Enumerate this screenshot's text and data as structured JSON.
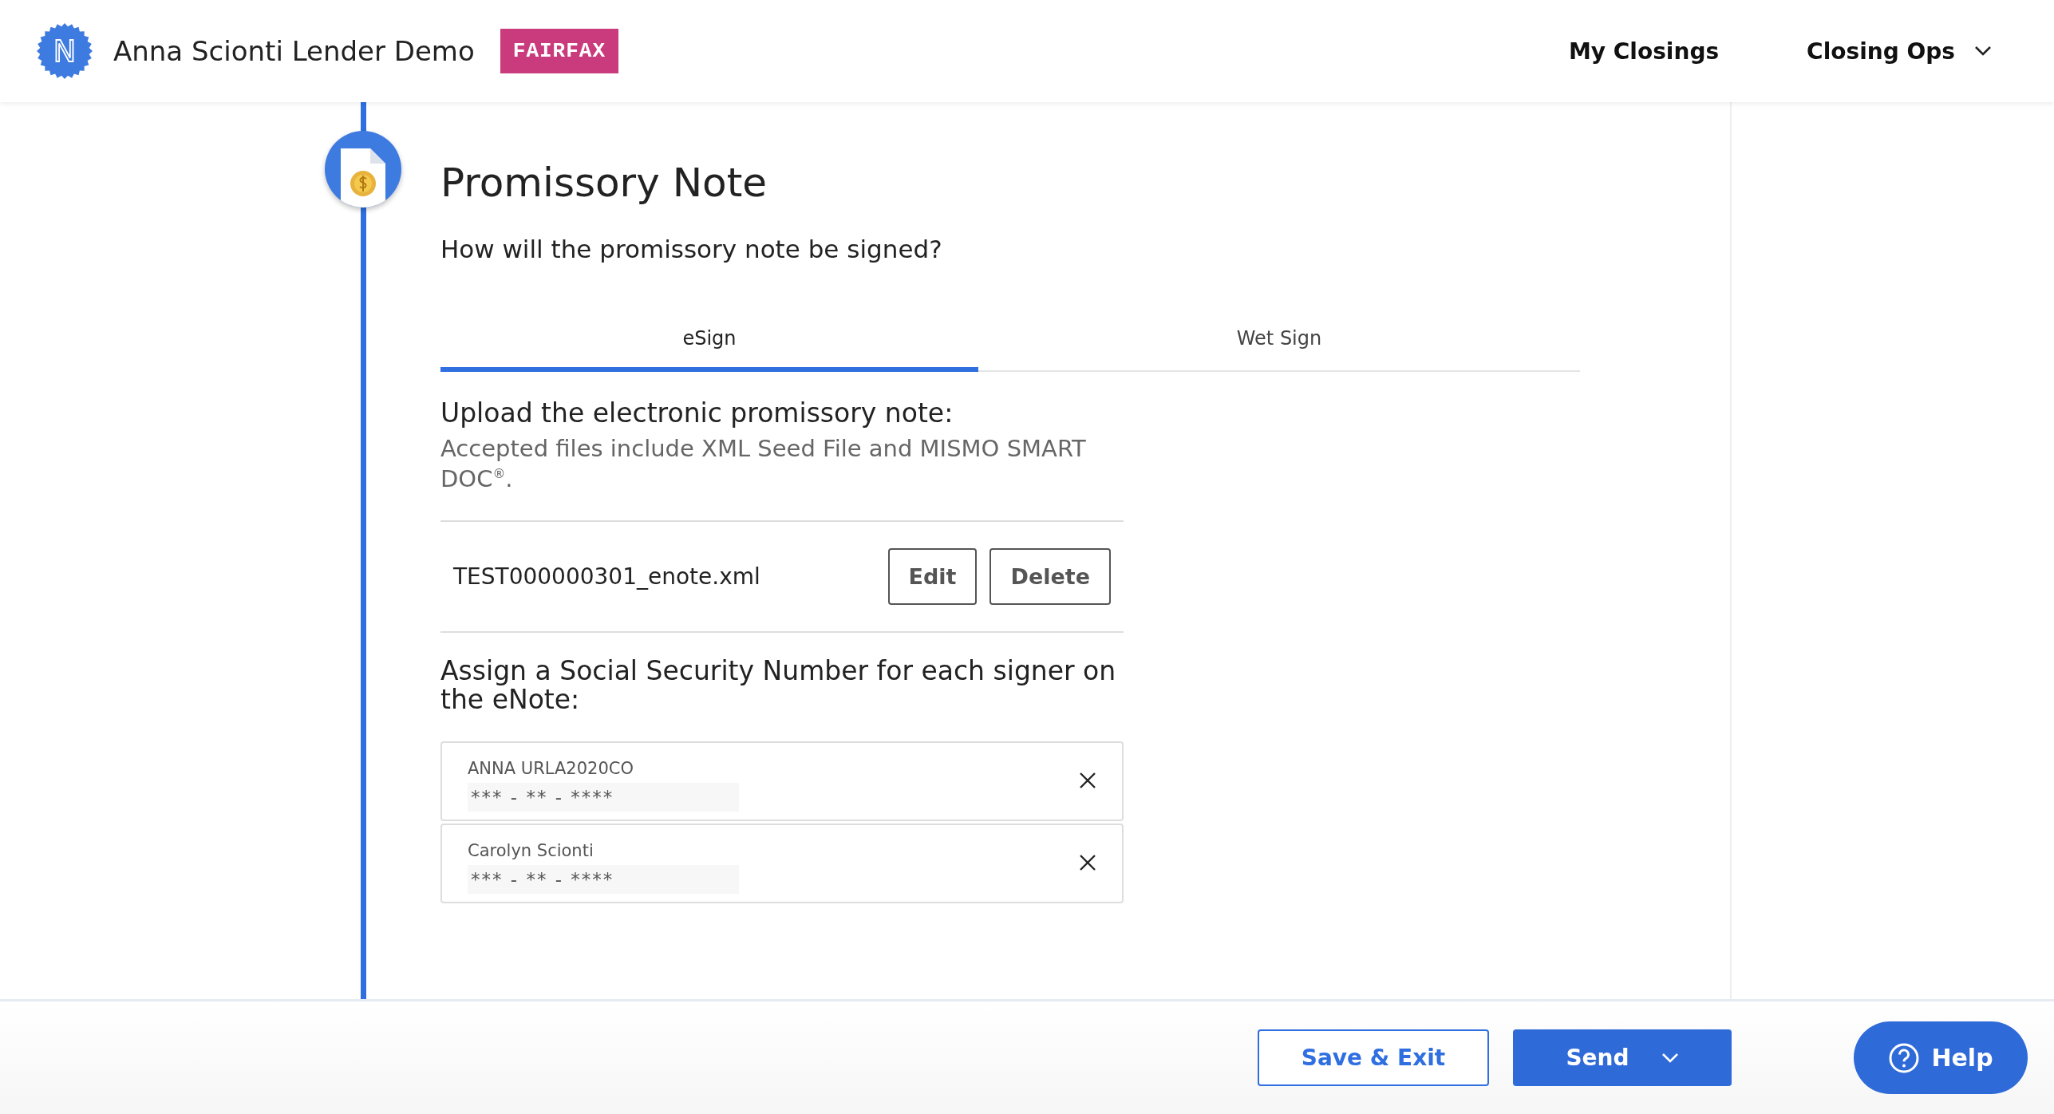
{
  "header": {
    "logo_letter": "N",
    "title": "Anna Scionti Lender Demo",
    "badge": "FAIRFAX",
    "nav": [
      {
        "label": "My Closings",
        "dropdown": false
      },
      {
        "label": "Closing Ops",
        "dropdown": true
      }
    ]
  },
  "step": {
    "title": "Promissory Note",
    "question": "How will the promissory note be signed?"
  },
  "tabs": [
    {
      "label": "eSign",
      "selected": true
    },
    {
      "label": "Wet Sign",
      "selected": false
    }
  ],
  "upload": {
    "heading": "Upload the electronic promissory note:",
    "hint": "Accepted files include XML Seed File and MISMO SMART DOC$^{®}$."
  },
  "file": {
    "name": "TEST000000301_enote.xml",
    "actions": [
      "Edit",
      "Delete"
    ]
  },
  "ssn": {
    "heading": "Assign a Social Security Number for each signer on the eNote:",
    "signers": [
      {
        "name": "ANNA URLA2020CO",
        "value": "*** - ** - ****"
      },
      {
        "name": "Carolyn Scionti",
        "value": "*** - ** - ****"
      }
    ]
  },
  "footer": {
    "buttons": [
      {
        "label": "Save & Exit",
        "kind": "outline",
        "dropdown": false
      },
      {
        "label": "Send",
        "kind": "primary",
        "dropdown": true
      }
    ],
    "help": "Help"
  }
}
